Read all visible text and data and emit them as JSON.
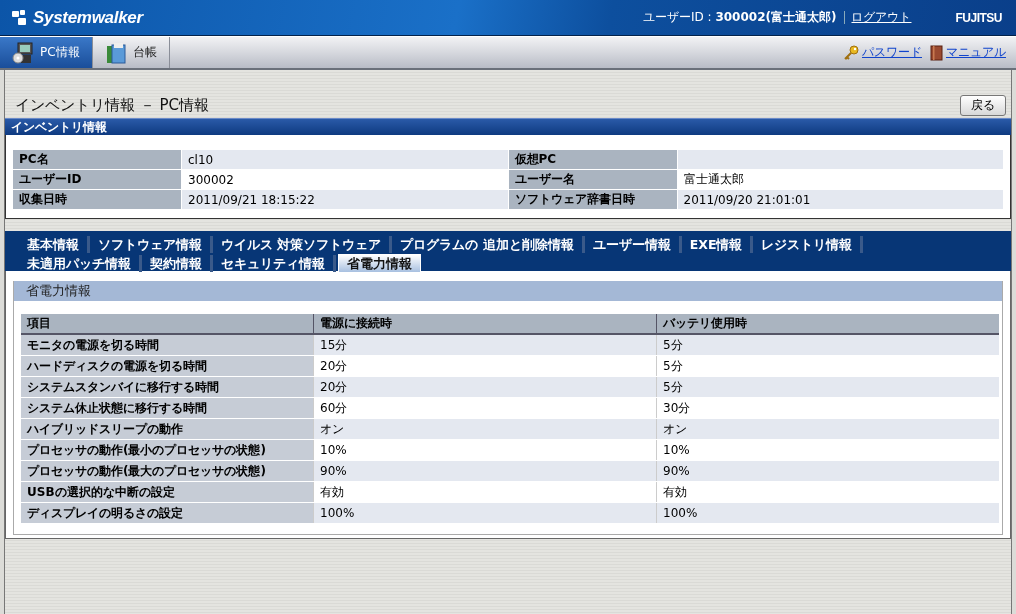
{
  "header": {
    "logo": "Systemwalker",
    "user": "ユーザーID : **300002(富士通太郎)**",
    "logout": "ログアウト",
    "brand": "FUJITSU"
  },
  "nav": {
    "tabs": [
      {
        "label": "PC情報",
        "selected": true,
        "kind": "pc"
      },
      {
        "label": "台帳",
        "selected": false,
        "kind": "ledger"
      }
    ],
    "links": [
      {
        "label": "パスワード",
        "kind": "key"
      },
      {
        "label": "マニュアル",
        "kind": "manual"
      }
    ]
  },
  "page": {
    "title": "インベントリ情報 － PC情報",
    "back_button": "戻る"
  },
  "inventory": {
    "heading": "インベントリ情報",
    "rows": [
      [
        {
          "label": "PC名",
          "value": "cl10"
        },
        {
          "label": "仮想PC"
        }
      ],
      [
        {
          "label": "ユーザーID",
          "value": "300002"
        },
        {
          "label": "ユーザー名",
          "value": "富士通太郎"
        }
      ],
      [
        {
          "label": "収集日時",
          "value": "2011/09/21 18:15:22"
        },
        {
          "label": "ソフトウェア辞書日時",
          "value": "2011/09/20 21:01:01"
        }
      ]
    ]
  },
  "tab_rows": [
    [
      {
        "label": "基本情報",
        "selected": false
      },
      {
        "label": "ソフトウェア情報",
        "selected": false
      },
      {
        "label": "ウイルス 対策ソフトウェア",
        "selected": false
      },
      {
        "label": "プログラムの 追加と削除情報",
        "selected": false
      },
      {
        "label": "ユーザー情報",
        "selected": false
      },
      {
        "label": "EXE情報",
        "selected": false
      },
      {
        "label": "レジストリ情報",
        "selected": false
      }
    ],
    [
      {
        "label": "未適用パッチ情報",
        "selected": false
      },
      {
        "label": "契約情報",
        "selected": false
      },
      {
        "label": "セキュリティ情報",
        "selected": false
      },
      {
        "label": "省電力情報",
        "selected": true
      }
    ]
  ],
  "power": {
    "heading": "省電力情報",
    "columns": [
      "項目",
      "電源に接続時",
      "バッテリ使用時"
    ],
    "rows": [
      [
        "モニタの電源を切る時間",
        "15分",
        "5分"
      ],
      [
        "ハードディスクの電源を切る時間",
        "20分",
        "5分"
      ],
      [
        "システムスタンバイに移行する時間",
        "20分",
        "5分"
      ],
      [
        "システム休止状態に移行する時間",
        "60分",
        "30分"
      ],
      [
        "ハイブリッドスリープの動作",
        "オン",
        "オン"
      ],
      [
        "プロセッサの動作(最小のプロセッサの状態)",
        "10%",
        "10%"
      ],
      [
        "プロセッサの動作(最大のプロセッサの状態)",
        "90%",
        "90%"
      ],
      [
        "USBの選択的な中断の設定",
        "有効",
        "有効"
      ],
      [
        "ディスプレイの明るさの設定",
        "100%",
        "100%"
      ]
    ]
  }
}
